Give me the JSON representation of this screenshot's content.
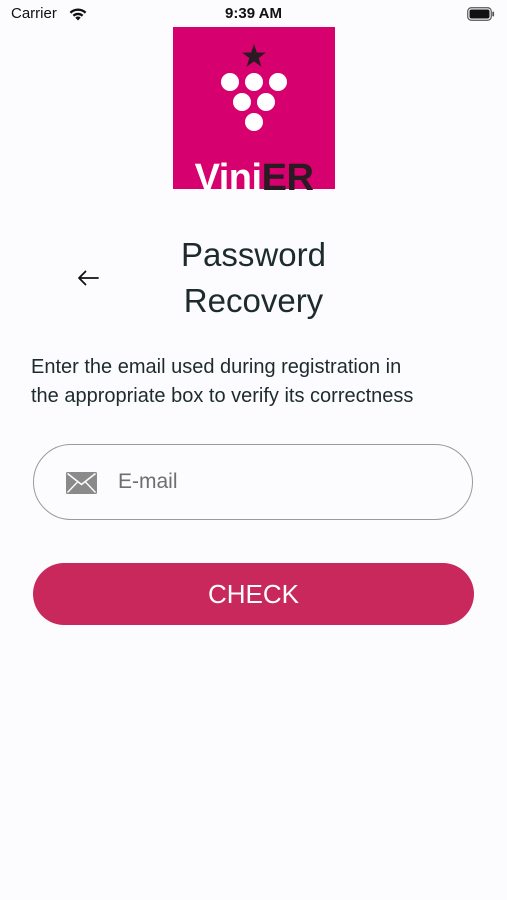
{
  "status_bar": {
    "carrier": "Carrier",
    "time": "9:39 AM",
    "wifi_icon": "wifi-icon",
    "battery_icon": "battery-icon"
  },
  "logo": {
    "brand_color": "#d6006e",
    "wordmark_part1": "Vini",
    "wordmark_part2": "ER",
    "icon": "grape-star-logo"
  },
  "header": {
    "back_icon": "arrow-left-icon",
    "title_line1": "Password",
    "title_line2": "Recovery"
  },
  "instructions": {
    "line1": "Enter the email used during registration in",
    "line2": "the appropriate box to verify its correctness"
  },
  "email_field": {
    "icon": "mail-icon",
    "placeholder": "E-mail",
    "value": ""
  },
  "check_button": {
    "label": "CHECK",
    "color": "#c8285c"
  }
}
